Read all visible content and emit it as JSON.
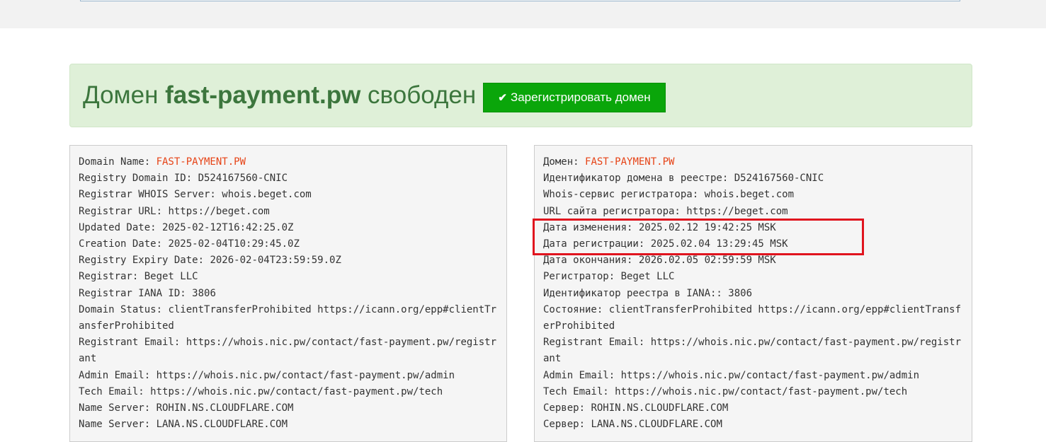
{
  "alert": {
    "prefix": "Домен ",
    "domain": "fast-payment.pw",
    "suffix": " свободен",
    "button_label": "Зарегистрировать домен",
    "button_icon": "check-icon"
  },
  "whois_en": [
    {
      "key": "Domain Name: ",
      "value": "FAST-PAYMENT.PW",
      "highlight": true
    },
    {
      "key": "Registry Domain ID: ",
      "value": "D524167560-CNIC"
    },
    {
      "key": "Registrar WHOIS Server: ",
      "value": "whois.beget.com"
    },
    {
      "key": "Registrar URL: ",
      "value": "https://beget.com"
    },
    {
      "key": "Updated Date: ",
      "value": "2025-02-12T16:42:25.0Z"
    },
    {
      "key": "Creation Date: ",
      "value": "2025-02-04T10:29:45.0Z"
    },
    {
      "key": "Registry Expiry Date: ",
      "value": "2026-02-04T23:59:59.0Z"
    },
    {
      "key": "Registrar: ",
      "value": "Beget LLC"
    },
    {
      "key": "Registrar IANA ID: ",
      "value": "3806"
    },
    {
      "key": "Domain Status: ",
      "value": "clientTransferProhibited https://icann.org/epp#clientTransferProhibited"
    },
    {
      "key": "Registrant Email: ",
      "value": "https://whois.nic.pw/contact/fast-payment.pw/registrant"
    },
    {
      "key": "Admin Email: ",
      "value": "https://whois.nic.pw/contact/fast-payment.pw/admin"
    },
    {
      "key": "Tech Email: ",
      "value": "https://whois.nic.pw/contact/fast-payment.pw/tech"
    },
    {
      "key": "Name Server: ",
      "value": "ROHIN.NS.CLOUDFLARE.COM"
    },
    {
      "key": "Name Server: ",
      "value": "LANA.NS.CLOUDFLARE.COM"
    }
  ],
  "whois_ru": [
    {
      "key": "Домен: ",
      "value": "FAST-PAYMENT.PW",
      "highlight": true
    },
    {
      "key": "Идентификатор домена в реестре: ",
      "value": "D524167560-CNIC"
    },
    {
      "key": "Whois-сервис регистратора: ",
      "value": "whois.beget.com"
    },
    {
      "key": "URL сайта регистратора: ",
      "value": "https://beget.com"
    },
    {
      "key": "Дата изменения: ",
      "value": "2025.02.12 19:42:25 MSK"
    },
    {
      "key": "Дата регистрации: ",
      "value": "2025.02.04 13:29:45 MSK"
    },
    {
      "key": "Дата окончания: ",
      "value": "2026.02.05 02:59:59 MSK"
    },
    {
      "key": "Регистратор: ",
      "value": "Beget LLC"
    },
    {
      "key": "Идентификатор реестра в IANA:: ",
      "value": "3806"
    },
    {
      "key": "Состояние: ",
      "value": "clientTransferProhibited https://icann.org/epp#clientTransferProhibited"
    },
    {
      "key": "Registrant Email: ",
      "value": "https://whois.nic.pw/contact/fast-payment.pw/registrant"
    },
    {
      "key": "Admin Email: ",
      "value": "https://whois.nic.pw/contact/fast-payment.pw/admin"
    },
    {
      "key": "Tech Email: ",
      "value": "https://whois.nic.pw/contact/fast-payment.pw/tech"
    },
    {
      "key": "Сервер: ",
      "value": "ROHIN.NS.CLOUDFLARE.COM"
    },
    {
      "key": "Сервер: ",
      "value": "LANA.NS.CLOUDFLARE.COM"
    }
  ],
  "colors": {
    "alert_bg": "#dff0d8",
    "alert_text": "#3c763d",
    "button_bg": "#0aa60a",
    "domain_highlight": "#e64316",
    "annotation_box": "#e0141e"
  }
}
